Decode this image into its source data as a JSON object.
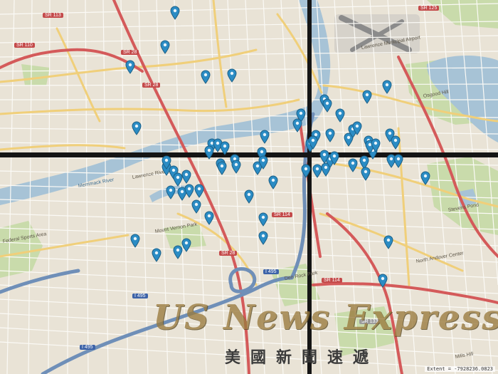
{
  "map": {
    "colors": {
      "land": "#e9e3d6",
      "water": "#a7c3d6",
      "park": "#c9dbab",
      "highway": "#d45a5a",
      "major_road": "#f0cf7a",
      "local_road": "#fbfaf6",
      "marker": "#2b8cc4"
    },
    "labels": [
      {
        "text": "Lawrence Riverfront",
        "kind": "place"
      },
      {
        "text": "Lawrence Municipal Airport",
        "kind": "place"
      },
      {
        "text": "Osgood Hill",
        "kind": "place"
      },
      {
        "text": "Stevens Pond",
        "kind": "place"
      },
      {
        "text": "Den Rock Park",
        "kind": "place"
      },
      {
        "text": "Federal Sports Area",
        "kind": "place"
      },
      {
        "text": "Mount Vernon Park",
        "kind": "place"
      },
      {
        "text": "North Andover Center",
        "kind": "place"
      },
      {
        "text": "Mills Hill",
        "kind": "place"
      },
      {
        "text": "Merrimack River",
        "kind": "water"
      }
    ],
    "shields": [
      {
        "text": "SR 113",
        "kind": "state"
      },
      {
        "text": "SR 28",
        "kind": "state"
      },
      {
        "text": "SR 28",
        "kind": "state"
      },
      {
        "text": "SR 28",
        "kind": "state"
      },
      {
        "text": "SR 110",
        "kind": "state"
      },
      {
        "text": "SR 114",
        "kind": "state"
      },
      {
        "text": "SR 114",
        "kind": "state"
      },
      {
        "text": "SR 125",
        "kind": "state"
      },
      {
        "text": "I 495",
        "kind": "interstate"
      },
      {
        "text": "I 495",
        "kind": "interstate"
      },
      {
        "text": "I 495",
        "kind": "interstate"
      },
      {
        "text": "SR 133",
        "kind": "state"
      }
    ],
    "marker_count": 71,
    "marker_icon": "map-pin-icon",
    "extent_text": "Extent = -7928236.0823"
  },
  "watermark": {
    "title": "US News Express",
    "subtitle": "美國新聞速遞"
  }
}
